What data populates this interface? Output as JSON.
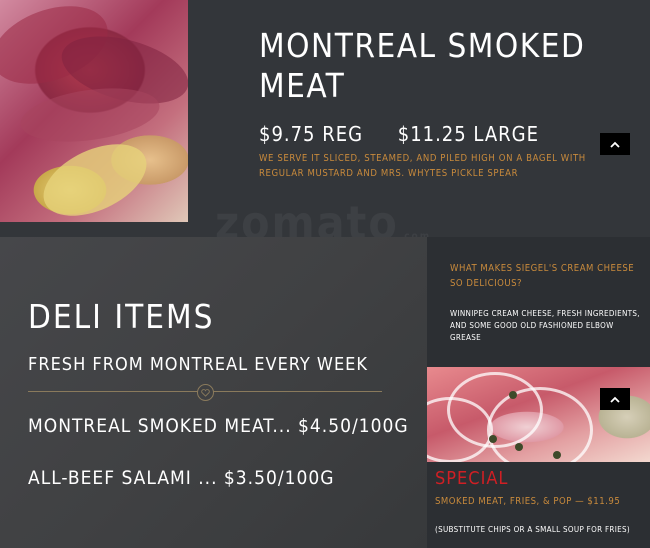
{
  "top": {
    "title": "MONTREAL SMOKED MEAT",
    "price_reg": "$9.75 REG",
    "price_large": "$11.25 LARGE",
    "description": "WE SERVE IT SLICED, STEAMED, AND PILED HIGH ON A BAGEL WITH REGULAR MUSTARD AND MRS. WHYTES PICKLE SPEAR"
  },
  "watermark": {
    "text": "zomato",
    "suffix": ".com"
  },
  "deli": {
    "title": "DELI ITEMS",
    "subtitle": "FRESH FROM MONTREAL EVERY WEEK",
    "items": [
      {
        "label": "MONTREAL SMOKED MEAT... $4.50/100G"
      },
      {
        "label": "ALL-BEEF SALAMI ... $3.50/100G"
      }
    ]
  },
  "side": {
    "question": "WHAT MAKES SIEGEL'S CREAM CHEESE SO DELICIOUS?",
    "answer": "WINNIPEG CREAM CHEESE, FRESH INGREDIENTS, AND SOME GOOD OLD FASHIONED ELBOW GREASE"
  },
  "special": {
    "title": "SPECIAL",
    "description": "SMOKED MEAT, FRIES, & POP — $11.95",
    "note": "(SUBSTITUTE CHIPS OR A SMALL SOUP FOR FRIES)"
  },
  "colors": {
    "accent": "#c88a3c",
    "special": "#d01f24",
    "dark_panel": "#2c2f33"
  },
  "icons": {
    "scroll_up": "chevron-up-icon",
    "divider": "heart-icon"
  }
}
